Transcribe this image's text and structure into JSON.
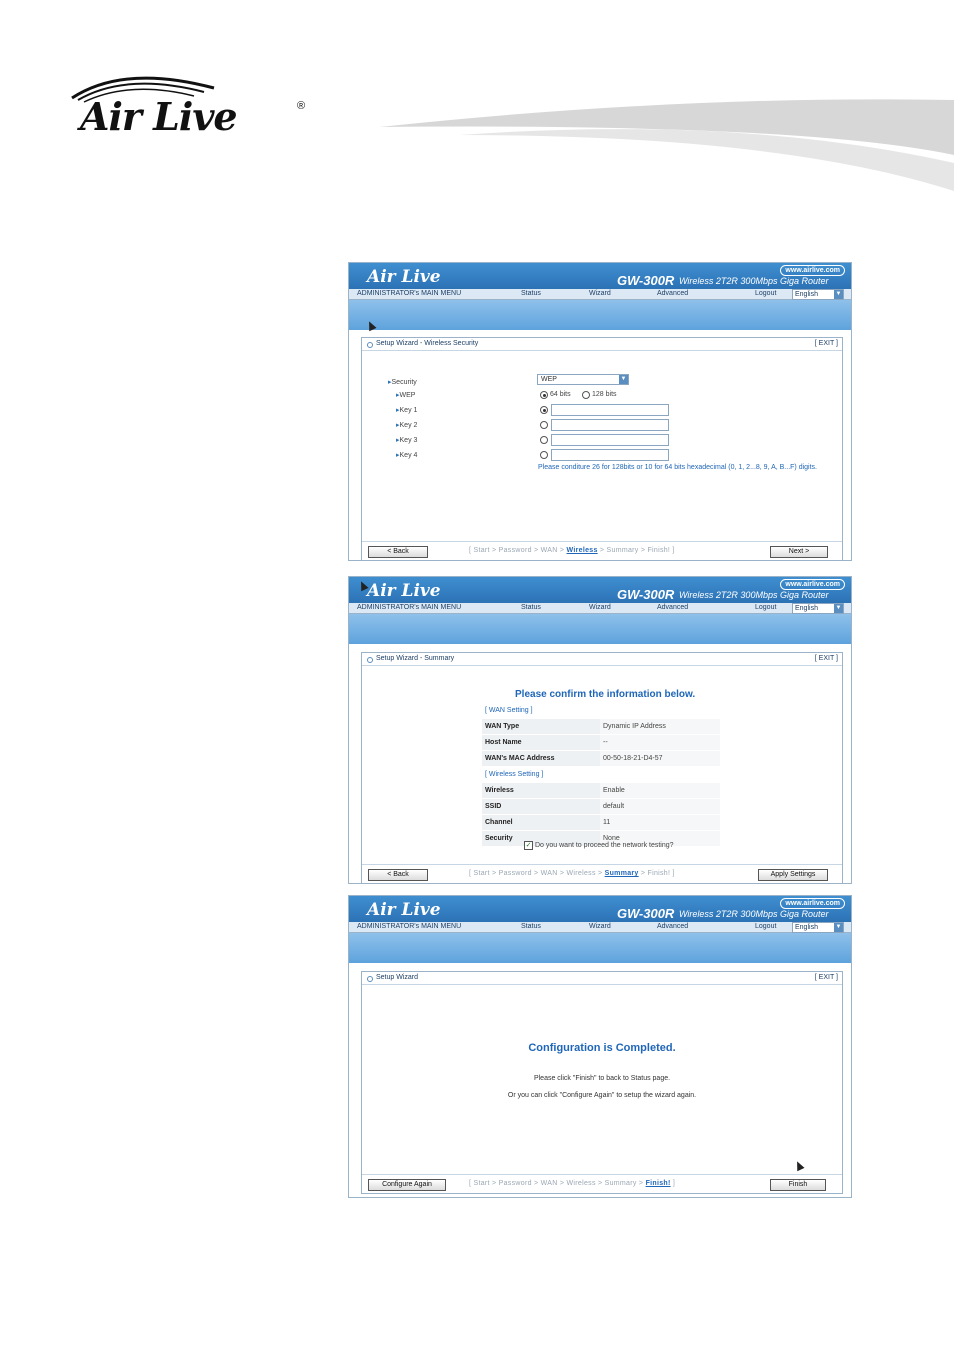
{
  "page": {
    "logo_text": "Air Live",
    "logo_registered": "®"
  },
  "router": {
    "brand": "Air Live",
    "model": "GW-300R",
    "tagline": "Wireless 2T2R 300Mbps Giga Router",
    "url": "www.airlive.com",
    "menu": {
      "admin": "ADMINISTRATOR's MAIN MENU",
      "status": "Status",
      "wizard": "Wizard",
      "advanced": "Advanced",
      "logout": "Logout",
      "language": "English"
    },
    "exit_label": "[ EXIT ]"
  },
  "screen1": {
    "title": "Setup Wizard - Wireless Security",
    "security_label": "Security",
    "security_value": "WEP",
    "wep_label": "WEP",
    "wep_opt1": "64 bits",
    "wep_opt2": "128 bits",
    "key1": "Key 1",
    "key2": "Key 2",
    "key3": "Key 3",
    "key4": "Key 4",
    "note": "Please conditure 26 for 128bits or 10 for 64 bits hexadecimal (0, 1, 2...8, 9, A, B...F) digits.",
    "back": "< Back",
    "next": "Next >",
    "crumb_pre": "[ Start > Password > WAN > ",
    "crumb_cur": "Wireless",
    "crumb_post": " > Summary > Finish! ]"
  },
  "screen2": {
    "title": "Setup Wizard - Summary",
    "confirm": "Please confirm the information below.",
    "wan_section": "[ WAN Setting ]",
    "wireless_section": "[ Wireless Setting ]",
    "wan_rows": [
      {
        "k": "WAN Type",
        "v": "Dynamic IP Address"
      },
      {
        "k": "Host Name",
        "v": "--"
      },
      {
        "k": "WAN's MAC Address",
        "v": "00-50-18-21-D4-57"
      }
    ],
    "wireless_rows": [
      {
        "k": "Wireless",
        "v": "Enable"
      },
      {
        "k": "SSID",
        "v": "default"
      },
      {
        "k": "Channel",
        "v": "11"
      },
      {
        "k": "Security",
        "v": "None"
      }
    ],
    "test_label": "Do you want to proceed the network testing?",
    "back": "< Back",
    "apply": "Apply Settings",
    "crumb_pre": "[ Start > Password > WAN > Wireless > ",
    "crumb_cur": "Summary",
    "crumb_post": " > Finish! ]"
  },
  "screen3": {
    "title": "Setup Wizard",
    "heading": "Configuration is Completed.",
    "line1": "Please click \"Finish\" to back to Status page.",
    "line2": "Or you can click \"Configure Again\" to setup the wizard again.",
    "configure_again": "Configure Again",
    "finish": "Finish",
    "crumb_pre": "[ Start > Password > WAN > Wireless > Summary > ",
    "crumb_cur": "Finish!",
    "crumb_post": " ]"
  }
}
